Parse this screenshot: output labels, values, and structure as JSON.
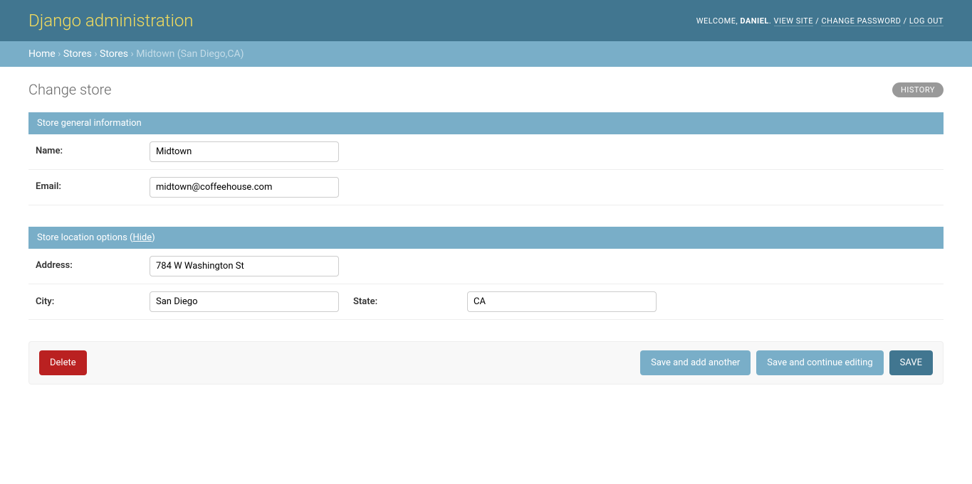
{
  "header": {
    "site_title": "Django administration",
    "welcome": "WELCOME, ",
    "username": "DANIEL",
    "view_site": "VIEW SITE",
    "change_password": "CHANGE PASSWORD",
    "log_out": "LOG OUT"
  },
  "breadcrumbs": {
    "home": "Home",
    "app": "Stores",
    "model": "Stores",
    "object": "Midtown (San Diego,CA)",
    "sep": " › "
  },
  "page": {
    "title": "Change store",
    "history": "HISTORY"
  },
  "fieldsets": {
    "general": {
      "title": "Store general information",
      "name_label": "Name:",
      "name_value": "Midtown",
      "email_label": "Email:",
      "email_value": "midtown@coffeehouse.com"
    },
    "location": {
      "title_prefix": "Store location options (",
      "hide": "Hide",
      "title_suffix": ")",
      "address_label": "Address:",
      "address_value": "784 W Washington St",
      "city_label": "City:",
      "city_value": "San Diego",
      "state_label": "State:",
      "state_value": "CA"
    }
  },
  "actions": {
    "delete": "Delete",
    "save_add_another": "Save and add another",
    "save_continue": "Save and continue editing",
    "save": "SAVE"
  }
}
